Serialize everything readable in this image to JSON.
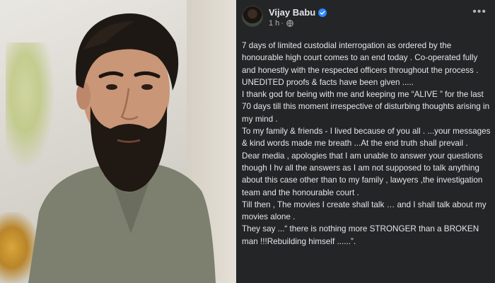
{
  "post": {
    "author": "Vijay Babu",
    "verified_icon": "verified-badge-icon",
    "time": "1 h",
    "separator": "·",
    "privacy_icon": "globe-icon",
    "more_icon": "more-options-icon",
    "paragraphs": [
      "7 days of limited custodial interrogation as ordered by the honourable high court comes to an end today . Co-operated fully and honestly with the respected officers throughout the process . UNEDITED proofs & facts have  been given .....",
      "I thank god for being with me and  keeping me “ALIVE ” for the last 70 days till this moment irrespective of disturbing thoughts arising in my mind .",
      "To my family  & friends - I lived because of you all . ...your messages & kind words made me breath ...At the end truth shall prevail  .",
      "Dear media , apologies that I am unable to answer your questions though I hv all the answers as I am not supposed to talk anything about this case other than to my family , lawyers ,the investigation team and the honourable court .",
      "Till then , The movies I create shall talk  … and I shall talk about my movies alone .",
      "They say ...“ there is nothing more STRONGER  than a BROKEN man !!!Rebuilding himself ......”."
    ]
  },
  "colors": {
    "panel_bg": "#242526",
    "text_primary": "#e4e6eb",
    "text_secondary": "#b0b3b8",
    "verified_blue": "#2d88ff"
  }
}
